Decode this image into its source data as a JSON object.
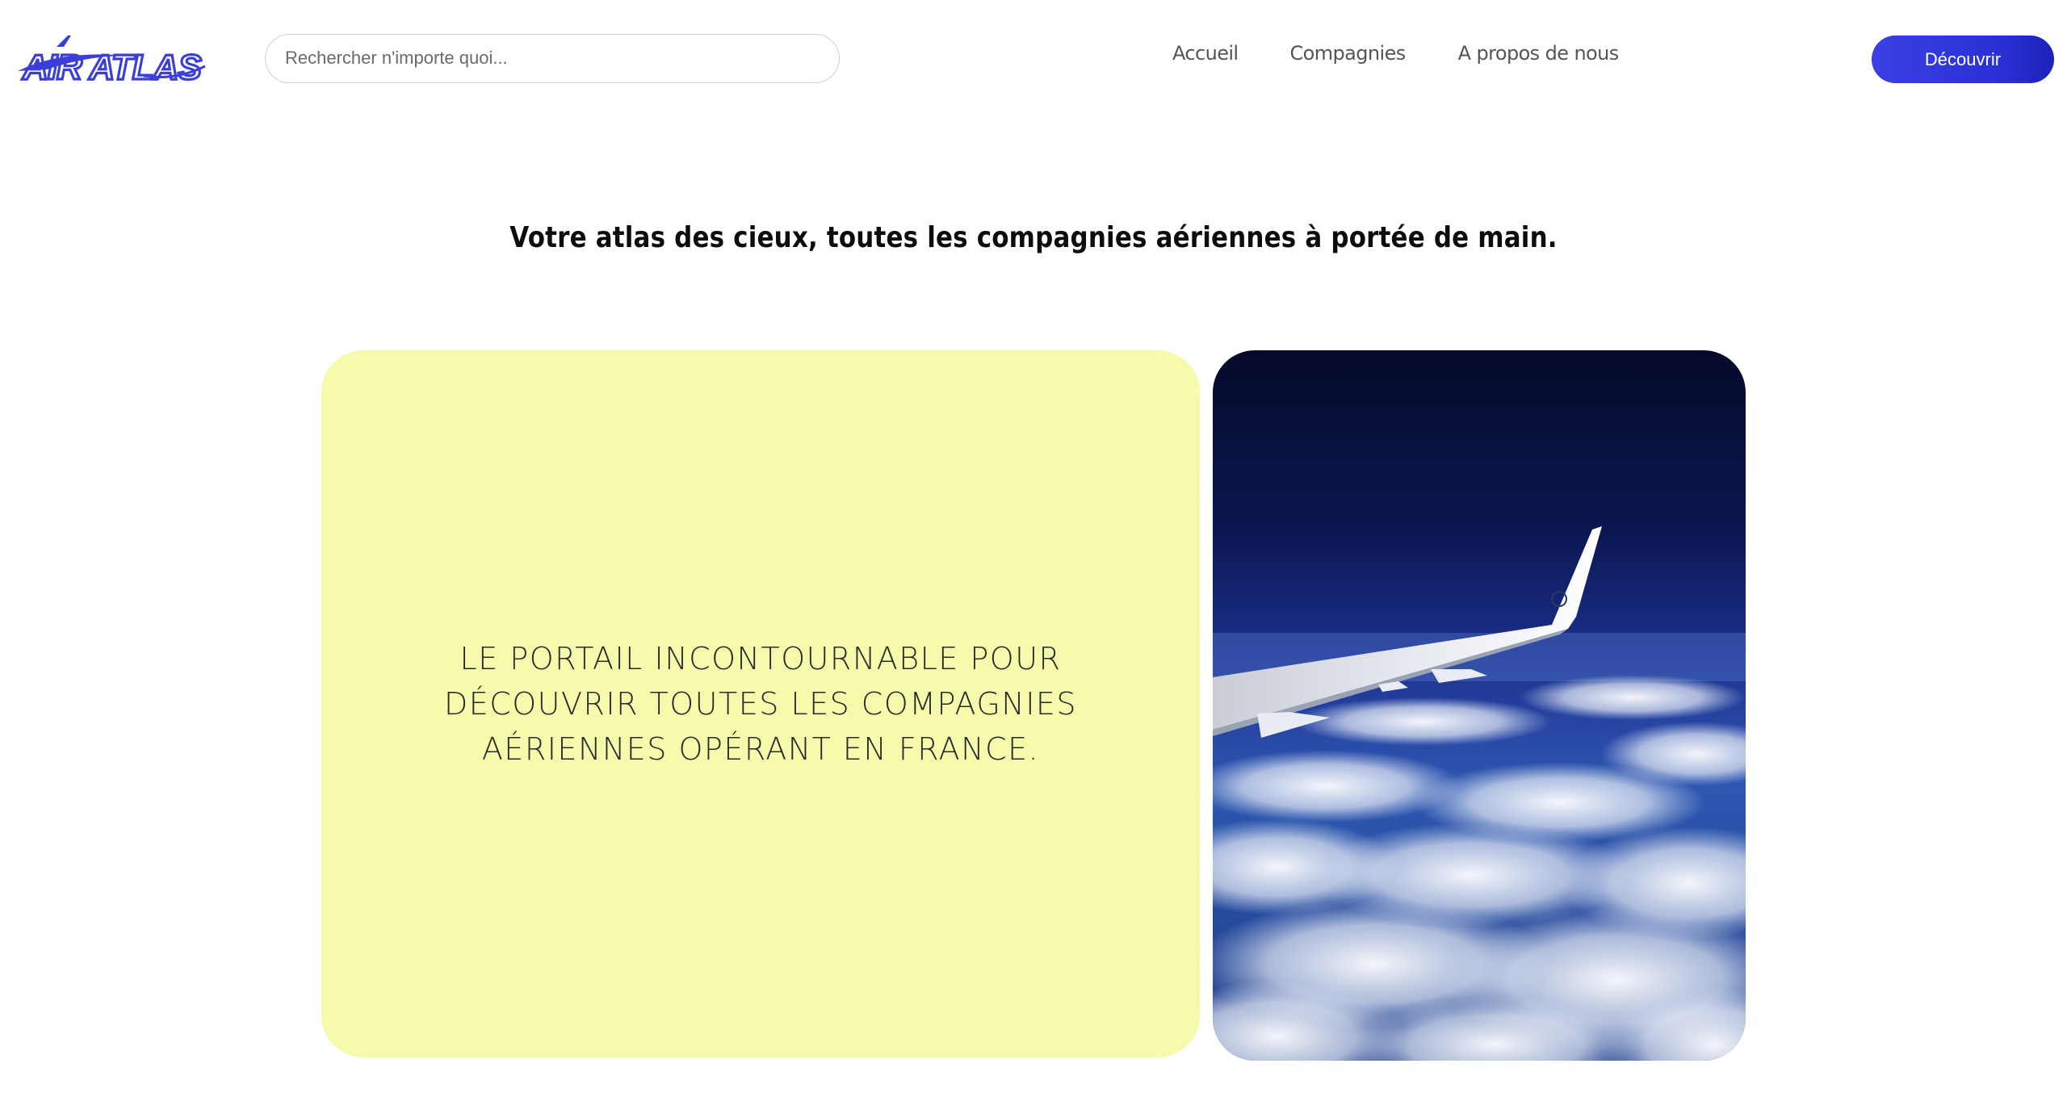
{
  "brand": {
    "logo_text": "AIR ATLAS",
    "logo_color": "#3b3fd8"
  },
  "search": {
    "placeholder": "Rechercher n'importe quoi..."
  },
  "nav": {
    "items": [
      {
        "label": "Accueil"
      },
      {
        "label": "Compagnies"
      },
      {
        "label": "A propos de nous"
      }
    ]
  },
  "cta": {
    "label": "Découvrir",
    "color": "#2f34dd"
  },
  "hero": {
    "tagline": "Votre atlas des cieux, toutes les compagnies aériennes à portée de main.",
    "card_text": "Le portail incontournable pour découvrir toutes les compagnies aériennes opérant en France.",
    "card_color": "#f6fbab",
    "image_subject": "airplane-wing-above-clouds"
  }
}
